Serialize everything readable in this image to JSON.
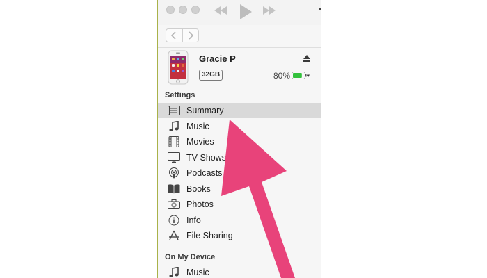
{
  "device": {
    "name": "Gracie P",
    "capacity": "32GB",
    "battery_percent": "80%",
    "battery_level": 0.8,
    "icons": {
      "phone": "iphone-icon",
      "eject": "eject-icon",
      "battery": "battery-charging-icon"
    }
  },
  "toolbar": {
    "icons": [
      "rewind-icon",
      "play-icon",
      "fast-forward-icon"
    ],
    "nav": [
      "back-arrow-icon",
      "forward-arrow-icon"
    ]
  },
  "settings": {
    "header": "Settings",
    "items": [
      {
        "label": "Summary",
        "icon": "summary-icon",
        "selected": true
      },
      {
        "label": "Music",
        "icon": "music-note-icon"
      },
      {
        "label": "Movies",
        "icon": "film-icon"
      },
      {
        "label": "TV Shows",
        "icon": "tv-icon"
      },
      {
        "label": "Podcasts",
        "icon": "podcast-icon"
      },
      {
        "label": "Books",
        "icon": "book-icon"
      },
      {
        "label": "Photos",
        "icon": "camera-icon"
      },
      {
        "label": "Info",
        "icon": "info-icon"
      },
      {
        "label": "File Sharing",
        "icon": "app-store-icon"
      }
    ]
  },
  "on_my_device": {
    "header": "On My Device",
    "items": [
      {
        "label": "Music",
        "icon": "music-note-icon"
      }
    ]
  },
  "colors": {
    "arrow": "#e8437a",
    "selection": "#d9d9d9",
    "sidebar_bg": "#f6f6f6",
    "battery_green": "#33c13c"
  },
  "annotation": {
    "icon": "pointer-arrow"
  }
}
